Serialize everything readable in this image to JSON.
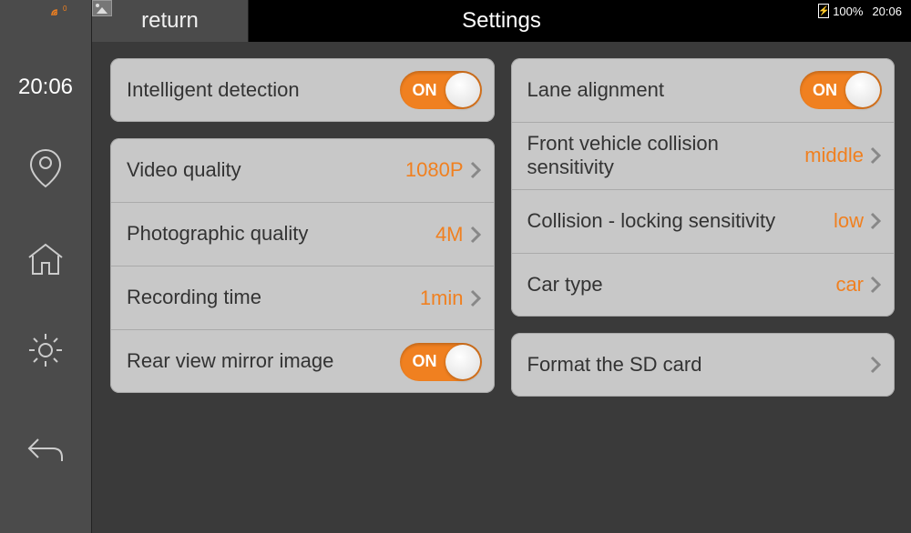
{
  "status": {
    "signal_text": "0",
    "battery_percent": "100%",
    "status_time": "20:06"
  },
  "sidebar": {
    "clock": "20:06"
  },
  "header": {
    "return_label": "return",
    "title": "Settings"
  },
  "settings": {
    "intelligent_detection": {
      "label": "Intelligent detection",
      "state": "ON"
    },
    "video_quality": {
      "label": "Video quality",
      "value": "1080P"
    },
    "photo_quality": {
      "label": "Photographic quality",
      "value": "4M"
    },
    "recording_time": {
      "label": "Recording time",
      "value": "1min"
    },
    "rear_view": {
      "label": "Rear view mirror image",
      "state": "ON"
    },
    "lane_alignment": {
      "label": "Lane alignment",
      "state": "ON"
    },
    "front_collision": {
      "label": "Front vehicle collision sensitivity",
      "value": "middle"
    },
    "collision_lock": {
      "label": "Collision - locking sensitivity",
      "value": "low"
    },
    "car_type": {
      "label": "Car type",
      "value": "car"
    },
    "format_sd": {
      "label": "Format the SD card"
    }
  }
}
